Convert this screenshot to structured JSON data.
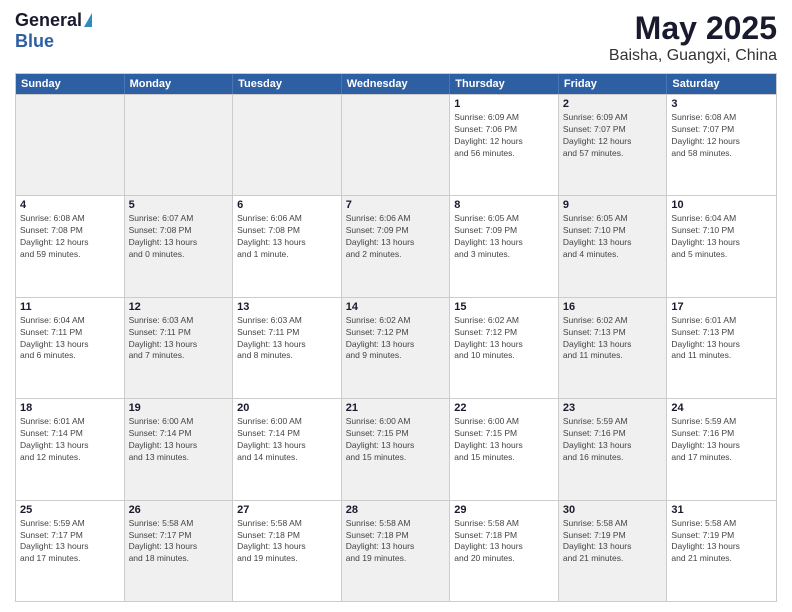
{
  "logo": {
    "general": "General",
    "blue": "Blue"
  },
  "header": {
    "title": "May 2025",
    "subtitle": "Baisha, Guangxi, China"
  },
  "weekdays": [
    "Sunday",
    "Monday",
    "Tuesday",
    "Wednesday",
    "Thursday",
    "Friday",
    "Saturday"
  ],
  "rows": [
    [
      {
        "day": "",
        "info": "",
        "shaded": true
      },
      {
        "day": "",
        "info": "",
        "shaded": true
      },
      {
        "day": "",
        "info": "",
        "shaded": true
      },
      {
        "day": "",
        "info": "",
        "shaded": true
      },
      {
        "day": "1",
        "info": "Sunrise: 6:09 AM\nSunset: 7:06 PM\nDaylight: 12 hours\nand 56 minutes.",
        "shaded": false
      },
      {
        "day": "2",
        "info": "Sunrise: 6:09 AM\nSunset: 7:07 PM\nDaylight: 12 hours\nand 57 minutes.",
        "shaded": true
      },
      {
        "day": "3",
        "info": "Sunrise: 6:08 AM\nSunset: 7:07 PM\nDaylight: 12 hours\nand 58 minutes.",
        "shaded": false
      }
    ],
    [
      {
        "day": "4",
        "info": "Sunrise: 6:08 AM\nSunset: 7:08 PM\nDaylight: 12 hours\nand 59 minutes.",
        "shaded": false
      },
      {
        "day": "5",
        "info": "Sunrise: 6:07 AM\nSunset: 7:08 PM\nDaylight: 13 hours\nand 0 minutes.",
        "shaded": true
      },
      {
        "day": "6",
        "info": "Sunrise: 6:06 AM\nSunset: 7:08 PM\nDaylight: 13 hours\nand 1 minute.",
        "shaded": false
      },
      {
        "day": "7",
        "info": "Sunrise: 6:06 AM\nSunset: 7:09 PM\nDaylight: 13 hours\nand 2 minutes.",
        "shaded": true
      },
      {
        "day": "8",
        "info": "Sunrise: 6:05 AM\nSunset: 7:09 PM\nDaylight: 13 hours\nand 3 minutes.",
        "shaded": false
      },
      {
        "day": "9",
        "info": "Sunrise: 6:05 AM\nSunset: 7:10 PM\nDaylight: 13 hours\nand 4 minutes.",
        "shaded": true
      },
      {
        "day": "10",
        "info": "Sunrise: 6:04 AM\nSunset: 7:10 PM\nDaylight: 13 hours\nand 5 minutes.",
        "shaded": false
      }
    ],
    [
      {
        "day": "11",
        "info": "Sunrise: 6:04 AM\nSunset: 7:11 PM\nDaylight: 13 hours\nand 6 minutes.",
        "shaded": false
      },
      {
        "day": "12",
        "info": "Sunrise: 6:03 AM\nSunset: 7:11 PM\nDaylight: 13 hours\nand 7 minutes.",
        "shaded": true
      },
      {
        "day": "13",
        "info": "Sunrise: 6:03 AM\nSunset: 7:11 PM\nDaylight: 13 hours\nand 8 minutes.",
        "shaded": false
      },
      {
        "day": "14",
        "info": "Sunrise: 6:02 AM\nSunset: 7:12 PM\nDaylight: 13 hours\nand 9 minutes.",
        "shaded": true
      },
      {
        "day": "15",
        "info": "Sunrise: 6:02 AM\nSunset: 7:12 PM\nDaylight: 13 hours\nand 10 minutes.",
        "shaded": false
      },
      {
        "day": "16",
        "info": "Sunrise: 6:02 AM\nSunset: 7:13 PM\nDaylight: 13 hours\nand 11 minutes.",
        "shaded": true
      },
      {
        "day": "17",
        "info": "Sunrise: 6:01 AM\nSunset: 7:13 PM\nDaylight: 13 hours\nand 11 minutes.",
        "shaded": false
      }
    ],
    [
      {
        "day": "18",
        "info": "Sunrise: 6:01 AM\nSunset: 7:14 PM\nDaylight: 13 hours\nand 12 minutes.",
        "shaded": false
      },
      {
        "day": "19",
        "info": "Sunrise: 6:00 AM\nSunset: 7:14 PM\nDaylight: 13 hours\nand 13 minutes.",
        "shaded": true
      },
      {
        "day": "20",
        "info": "Sunrise: 6:00 AM\nSunset: 7:14 PM\nDaylight: 13 hours\nand 14 minutes.",
        "shaded": false
      },
      {
        "day": "21",
        "info": "Sunrise: 6:00 AM\nSunset: 7:15 PM\nDaylight: 13 hours\nand 15 minutes.",
        "shaded": true
      },
      {
        "day": "22",
        "info": "Sunrise: 6:00 AM\nSunset: 7:15 PM\nDaylight: 13 hours\nand 15 minutes.",
        "shaded": false
      },
      {
        "day": "23",
        "info": "Sunrise: 5:59 AM\nSunset: 7:16 PM\nDaylight: 13 hours\nand 16 minutes.",
        "shaded": true
      },
      {
        "day": "24",
        "info": "Sunrise: 5:59 AM\nSunset: 7:16 PM\nDaylight: 13 hours\nand 17 minutes.",
        "shaded": false
      }
    ],
    [
      {
        "day": "25",
        "info": "Sunrise: 5:59 AM\nSunset: 7:17 PM\nDaylight: 13 hours\nand 17 minutes.",
        "shaded": false
      },
      {
        "day": "26",
        "info": "Sunrise: 5:58 AM\nSunset: 7:17 PM\nDaylight: 13 hours\nand 18 minutes.",
        "shaded": true
      },
      {
        "day": "27",
        "info": "Sunrise: 5:58 AM\nSunset: 7:18 PM\nDaylight: 13 hours\nand 19 minutes.",
        "shaded": false
      },
      {
        "day": "28",
        "info": "Sunrise: 5:58 AM\nSunset: 7:18 PM\nDaylight: 13 hours\nand 19 minutes.",
        "shaded": true
      },
      {
        "day": "29",
        "info": "Sunrise: 5:58 AM\nSunset: 7:18 PM\nDaylight: 13 hours\nand 20 minutes.",
        "shaded": false
      },
      {
        "day": "30",
        "info": "Sunrise: 5:58 AM\nSunset: 7:19 PM\nDaylight: 13 hours\nand 21 minutes.",
        "shaded": true
      },
      {
        "day": "31",
        "info": "Sunrise: 5:58 AM\nSunset: 7:19 PM\nDaylight: 13 hours\nand 21 minutes.",
        "shaded": false
      }
    ]
  ]
}
